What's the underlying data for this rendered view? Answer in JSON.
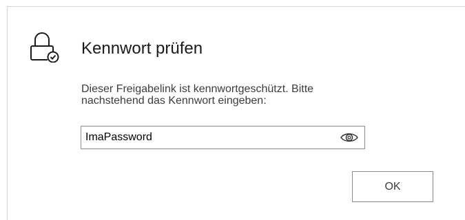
{
  "dialog": {
    "icon": "lock-check-icon",
    "title": "Kennwort prüfen",
    "message_line1": "Dieser Freigabelink ist kennwortgeschützt. Bitte",
    "message_line2": "nachstehend das Kennwort eingeben:",
    "password_value": "ImaPassword",
    "reveal_icon": "eye-icon",
    "ok_label": "OK"
  }
}
